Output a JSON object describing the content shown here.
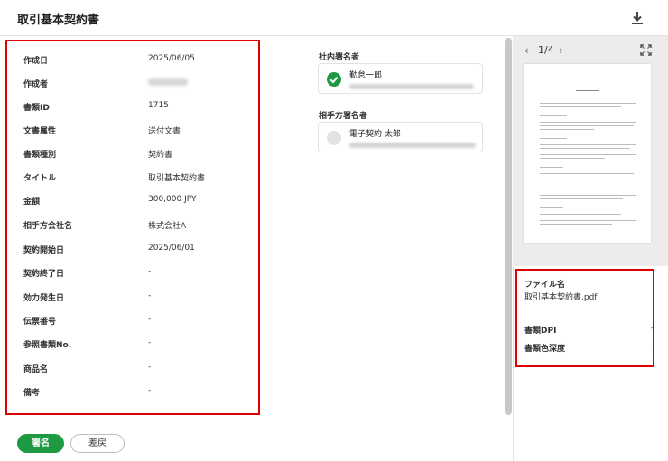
{
  "header": {
    "title": "取引基本契約書",
    "download_icon": "download-icon"
  },
  "details": {
    "rows": [
      {
        "label": "作成日",
        "value": "2025/06/05"
      },
      {
        "label": "作成者",
        "value": ""
      },
      {
        "label": "書類ID",
        "value": "1715"
      },
      {
        "label": "文書属性",
        "value": "送付文書"
      },
      {
        "label": "書類種別",
        "value": "契約書"
      },
      {
        "label": "タイトル",
        "value": "取引基本契約書"
      },
      {
        "label": "金額",
        "value": "300,000 JPY"
      },
      {
        "label": "相手方会社名",
        "value": "株式会社A"
      },
      {
        "label": "契約開始日",
        "value": "2025/06/01"
      },
      {
        "label": "契約終了日",
        "value": "-"
      },
      {
        "label": "効力発生日",
        "value": "-"
      },
      {
        "label": "伝票番号",
        "value": "-"
      },
      {
        "label": "参照書類No.",
        "value": "-"
      },
      {
        "label": "商品名",
        "value": "-"
      },
      {
        "label": "備考",
        "value": "-"
      }
    ]
  },
  "signers": {
    "internal_heading": "社内署名者",
    "internal_name": "勤怠一郎",
    "internal_status_icon": "check-circle-icon",
    "counterparty_heading": "相手方署名者",
    "counterparty_name": "電子契約 太郎",
    "counterparty_status_icon": "pending-circle-icon"
  },
  "preview": {
    "page_indicator": "1/4",
    "prev_icon": "chevron-left-icon",
    "next_icon": "chevron-right-icon",
    "expand_icon": "fullscreen-icon"
  },
  "file_info": {
    "filename_label": "ファイル名",
    "filename_value": "取引基本契約書.pdf",
    "dpi_label": "書類DPI",
    "dpi_value": "-",
    "color_depth_label": "書類色深度",
    "color_depth_value": "-"
  },
  "actions": {
    "sign_label": "署名",
    "reject_label": "差戻"
  },
  "colors": {
    "accent_green": "#1e9a43",
    "highlight_red": "#e00000"
  }
}
